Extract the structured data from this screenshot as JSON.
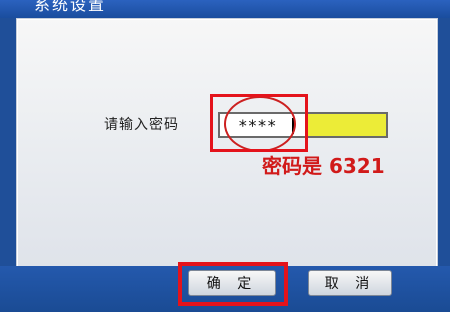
{
  "window": {
    "title": "系统设置"
  },
  "form": {
    "password_label": "请输入密码",
    "password_value": "****",
    "hint": "密码是 6321"
  },
  "buttons": {
    "ok": "确 定",
    "cancel": "取 消"
  },
  "colors": {
    "highlight_red": "#e4131b",
    "input_yellow": "#ecec37",
    "frame_blue": "#1f4f99"
  }
}
